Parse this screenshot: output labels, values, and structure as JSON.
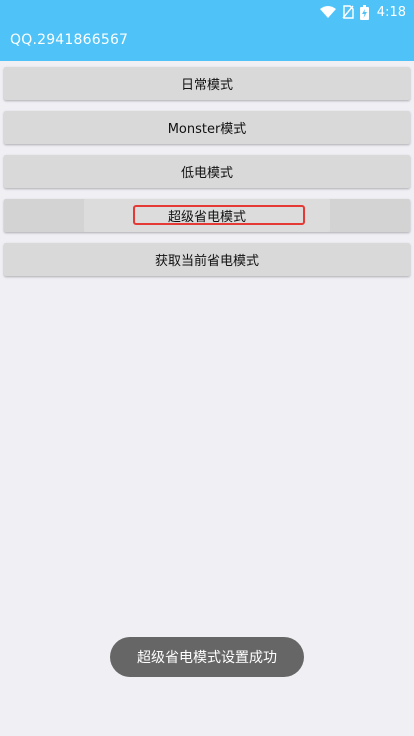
{
  "status_bar": {
    "time": "4:18",
    "icons": [
      "wifi-icon",
      "no-sim-icon",
      "battery-charging-icon"
    ]
  },
  "app_bar": {
    "title": "QQ.2941866567"
  },
  "buttons": [
    {
      "label": "日常模式"
    },
    {
      "label": "Monster模式"
    },
    {
      "label": "低电模式"
    },
    {
      "label": "超级省电模式"
    },
    {
      "label": "获取当前省电模式"
    }
  ],
  "toast": {
    "message": "超级省电模式设置成功"
  },
  "colors": {
    "app_bar": "#4fc3f7",
    "background": "#efeff4",
    "button": "#d9d9d9",
    "highlight": "#e53935",
    "toast": "#666666"
  }
}
